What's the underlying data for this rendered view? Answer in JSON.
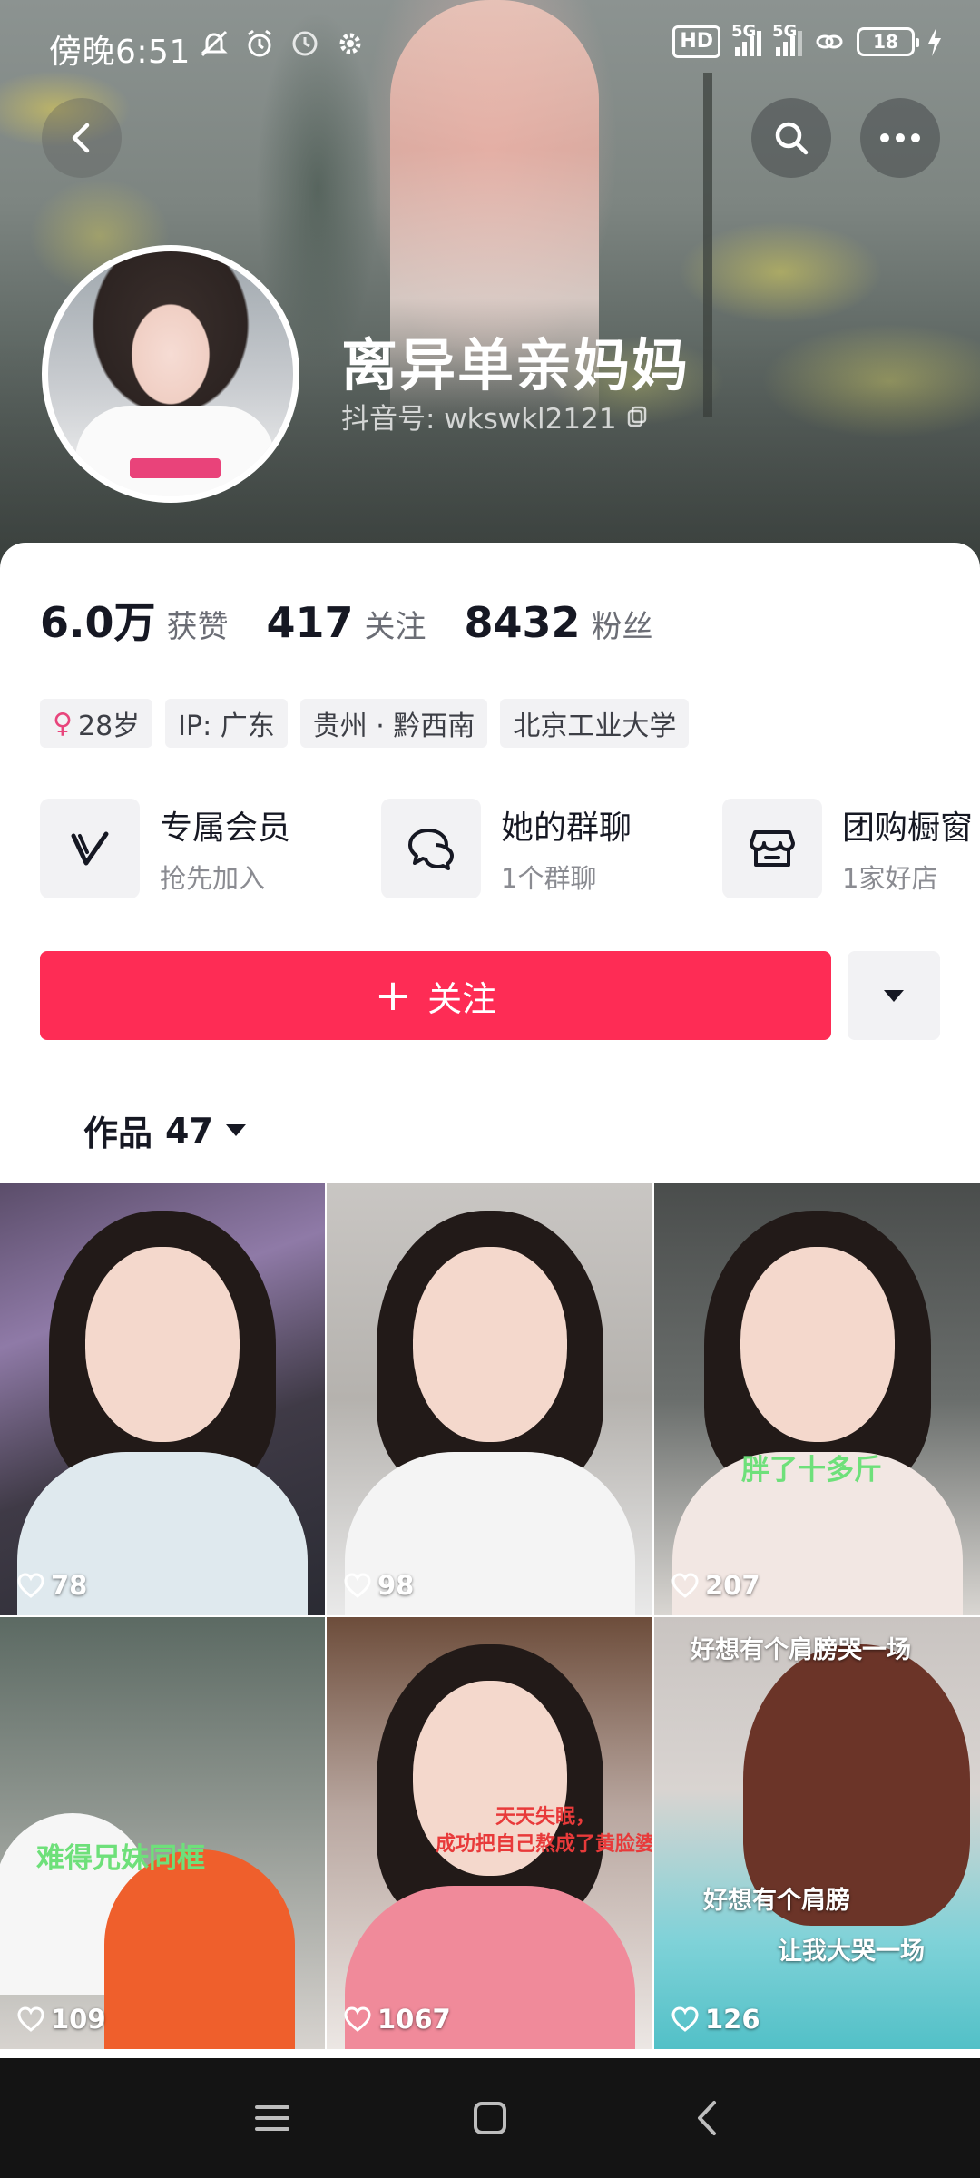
{
  "status_bar": {
    "time": "傍晚6:51",
    "hd_label": "HD",
    "network_1": "5G",
    "network_2": "5G",
    "battery": "18"
  },
  "profile": {
    "name": "离异单亲妈妈",
    "douyin_id": "抖音号: wkswkl2121"
  },
  "stats": [
    {
      "value": "6.0万",
      "label": "获赞"
    },
    {
      "value": "417",
      "label": "关注"
    },
    {
      "value": "8432",
      "label": "粉丝"
    }
  ],
  "tags": {
    "age": "28岁",
    "gender_symbol": "♀",
    "ip": "IP: 广东",
    "location": "贵州 · 黔西南",
    "school": "北京工业大学"
  },
  "features": [
    {
      "title": "专属会员",
      "subtitle": "抢先加入",
      "icon": "vip-v-icon"
    },
    {
      "title": "她的群聊",
      "subtitle": "1个群聊",
      "icon": "chat-bubbles-icon"
    },
    {
      "title": "团购橱窗",
      "subtitle": "1家好店",
      "icon": "store-icon"
    }
  ],
  "actions": {
    "follow_label": "关注",
    "follow_plus": "+"
  },
  "works_tab": {
    "label": "作品",
    "count": "47"
  },
  "videos": [
    {
      "likes": "78",
      "caption": ""
    },
    {
      "likes": "98",
      "caption": ""
    },
    {
      "likes": "207",
      "caption": "胖了十多斤"
    },
    {
      "likes": "109",
      "caption": "难得兄妹同框"
    },
    {
      "likes": "1067",
      "caption": "天天失眠，\n成功把自己熬成了黄脸婆"
    },
    {
      "likes": "126",
      "caption_top": "好想有个肩膀哭一场",
      "caption_mid": "好想有个肩膀",
      "caption_low": "让我大哭一场"
    }
  ],
  "colors": {
    "accent": "#fe2c55",
    "tag_bg": "#f2f2f4",
    "female": "#e8457c",
    "caption_green": "#6ee07a"
  }
}
